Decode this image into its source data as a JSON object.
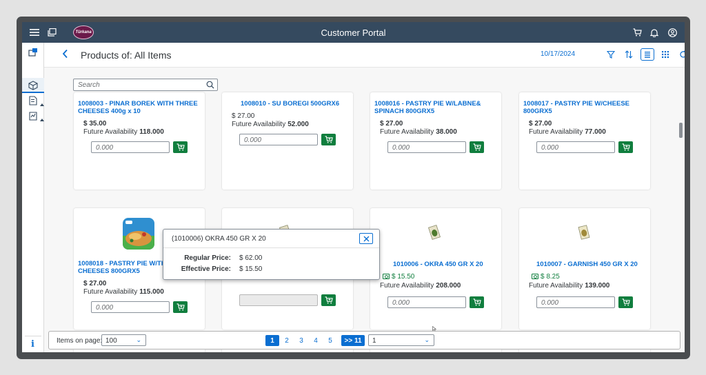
{
  "shell": {
    "title": "Customer Portal",
    "logo_text": "Türkana"
  },
  "header": {
    "title": "Products of: All Items",
    "date": "10/17/2024"
  },
  "search": {
    "placeholder": "Search"
  },
  "products": [
    {
      "title_l1": "1008003 - PINAR BOREK WITH THREE",
      "title_l2": "CHEESES 400g x 10",
      "price": "$ 35.00",
      "avail_label": "Future Availability",
      "avail": "118.000",
      "qty": "0.000"
    },
    {
      "title_l1": "1008010 - SU BOREGI 500GRX6",
      "title_l2": "",
      "price": "$ 27.00",
      "avail_label": "Future Availability",
      "avail": "52.000",
      "qty": "0.000"
    },
    {
      "title_l1": "1008016 - PASTRY PIE W/LABNE&",
      "title_l2": "SPINACH 800GRX5",
      "price": "$ 27.00",
      "avail_label": "Future Availability",
      "avail": "38.000",
      "qty": "0.000"
    },
    {
      "title_l1": "1008017 - PASTRY PIE W/CHEESE",
      "title_l2": "800GRX5",
      "price": "$ 27.00",
      "avail_label": "Future Availability",
      "avail": "77.000",
      "qty": "0.000"
    },
    {
      "title_l1": "1008018 - PASTRY PIE W/THE",
      "title_l2": "CHEESES 800GRX5",
      "price": "$ 27.00",
      "avail_label": "Future Availability",
      "avail": "115.000",
      "qty": "0.000"
    },
    {
      "title_l1": "",
      "title_l2": "",
      "price": "",
      "avail_label": "",
      "avail": "",
      "qty": ""
    },
    {
      "title_l1": "1010006 - OKRA 450 GR X 20",
      "title_l2": "",
      "price": "$ 15.50",
      "avail_label": "Future Availability",
      "avail": "208.000",
      "qty": "0.000"
    },
    {
      "title_l1": "1010007 - GARNISH 450 GR X 20",
      "title_l2": "",
      "price": "$ 8.25",
      "avail_label": "Future Availability",
      "avail": "139.000",
      "qty": "0.000"
    }
  ],
  "popover": {
    "title": "(1010006) OKRA 450 GR X 20",
    "regular_label": "Regular Price:",
    "regular_value": "$ 62.00",
    "effective_label": "Effective Price:",
    "effective_value": "$ 15.50"
  },
  "footer": {
    "items_label": "Items on page:",
    "items_value": "100",
    "pages": [
      "1",
      "2",
      "3",
      "4",
      "5"
    ],
    "jump": ">> 11",
    "page_select": "1"
  },
  "colors": {
    "shell": "#354a5f",
    "accent": "#0a6ed1",
    "cart": "#107e3e"
  },
  "icons": [
    "menu-icon",
    "windows-icon",
    "cart-icon",
    "bell-icon",
    "user-icon",
    "filter-icon",
    "sort-icon",
    "list-view-icon",
    "grid-view-icon",
    "refresh-icon",
    "search-icon",
    "info-icon"
  ]
}
